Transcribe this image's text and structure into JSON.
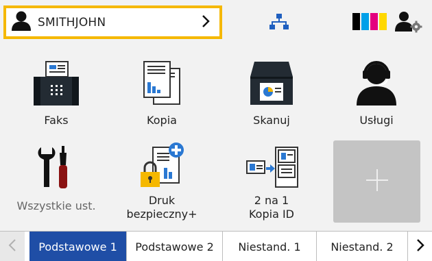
{
  "header": {
    "user_name": "SMITHJOHN",
    "icons": [
      "user-icon",
      "chevron-right-icon",
      "network-icon",
      "ink-levels-icon",
      "user-settings-icon"
    ],
    "ink_colors": [
      "#000000",
      "#00a0e9",
      "#e4007f",
      "#ffd800"
    ]
  },
  "tiles": [
    {
      "label": "Faks"
    },
    {
      "label": "Kopia"
    },
    {
      "label": "Skanuj"
    },
    {
      "label": "Usługi"
    },
    {
      "label": "Wszystkie ust."
    },
    {
      "label": "Druk bezpieczny+",
      "line1": "Druk",
      "line2": "bezpieczny+"
    },
    {
      "label": "2 na 1 Kopia ID",
      "line1": "2 na 1",
      "line2": "Kopia ID"
    }
  ],
  "tabs": [
    {
      "label": "Podstawowe 1",
      "active": true
    },
    {
      "label": "Podstawowe 2"
    },
    {
      "label": "Niestand. 1"
    },
    {
      "label": "Niestand. 2"
    }
  ],
  "colors": {
    "accent_border": "#f5b800",
    "active_tab": "#1f4ea6",
    "add_tile": "#c4c4c4"
  }
}
